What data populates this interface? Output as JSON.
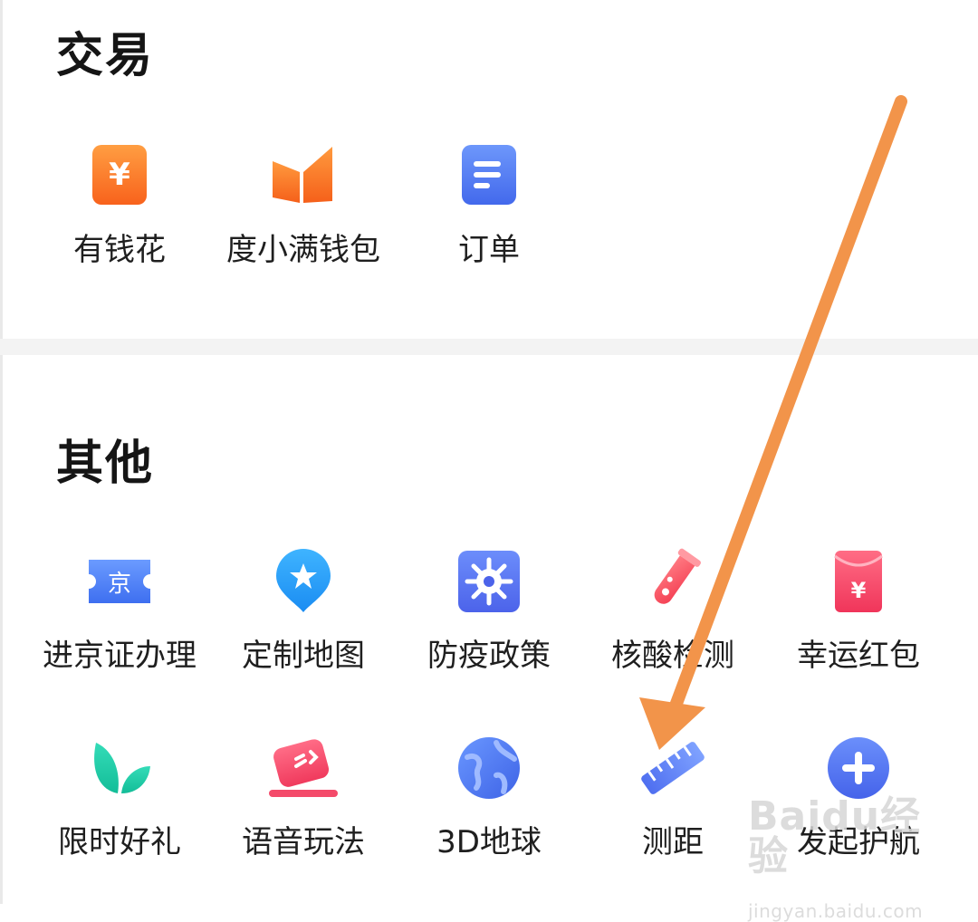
{
  "sections": [
    {
      "title": "交易",
      "items": [
        {
          "label": "有钱花",
          "icon": "yen-card-icon"
        },
        {
          "label": "度小满钱包",
          "icon": "wallet-icon"
        },
        {
          "label": "订单",
          "icon": "order-document-icon"
        }
      ]
    },
    {
      "title": "其他",
      "items": [
        {
          "label": "进京证办理",
          "icon": "beijing-ticket-icon"
        },
        {
          "label": "定制地图",
          "icon": "custom-map-pin-icon"
        },
        {
          "label": "防疫政策",
          "icon": "virus-icon"
        },
        {
          "label": "核酸检测",
          "icon": "test-tube-icon"
        },
        {
          "label": "幸运红包",
          "icon": "red-envelope-icon"
        },
        {
          "label": "限时好礼",
          "icon": "leaf-gift-icon"
        },
        {
          "label": "语音玩法",
          "icon": "voice-icon"
        },
        {
          "label": "3D地球",
          "icon": "globe-icon"
        },
        {
          "label": "测距",
          "icon": "ruler-icon"
        },
        {
          "label": "发起护航",
          "icon": "plus-circle-icon"
        }
      ]
    }
  ],
  "watermark": {
    "logo": "Baidu经验",
    "url": "jingyan.baidu.com"
  },
  "colors": {
    "orange": "#f97a1f",
    "blue": "#4d7cf4",
    "red": "#f6415f",
    "green": "#21ccaa",
    "arrow": "#f2944a"
  }
}
